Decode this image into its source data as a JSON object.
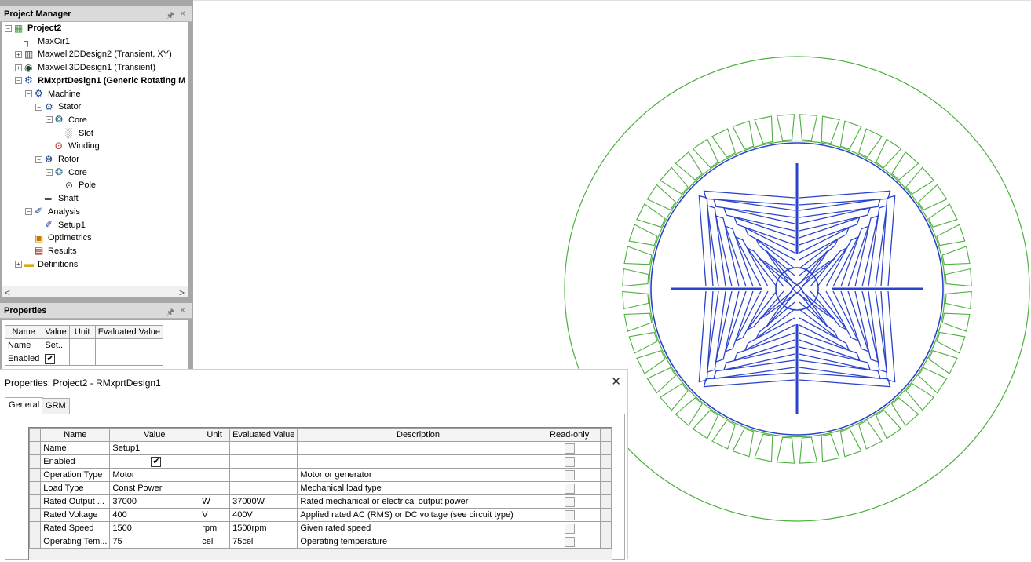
{
  "project_manager": {
    "title": "Project Manager",
    "pin": "↕",
    "close": "×",
    "tree": [
      {
        "label": "Project2",
        "level": 0,
        "toggle": "−",
        "icon": "project-icon",
        "bold": true
      },
      {
        "label": "MaxCir1",
        "level": 1,
        "toggle": "",
        "icon": "circuit-icon",
        "bold": false
      },
      {
        "label": "Maxwell2DDesign2 (Transient, XY)",
        "level": 1,
        "toggle": "+",
        "icon": "maxwell2d-icon",
        "bold": false
      },
      {
        "label": "Maxwell3DDesign1 (Transient)",
        "level": 1,
        "toggle": "+",
        "icon": "maxwell3d-icon",
        "bold": false
      },
      {
        "label": "RMxprtDesign1 (Generic Rotating M",
        "level": 1,
        "toggle": "−",
        "icon": "rmxprt-icon",
        "bold": true
      },
      {
        "label": "Machine",
        "level": 2,
        "toggle": "−",
        "icon": "machine-icon",
        "bold": false
      },
      {
        "label": "Stator",
        "level": 3,
        "toggle": "−",
        "icon": "stator-icon",
        "bold": false
      },
      {
        "label": "Core",
        "level": 4,
        "toggle": "−",
        "icon": "core-icon",
        "bold": false
      },
      {
        "label": "Slot",
        "level": 5,
        "toggle": "",
        "icon": "slot-icon",
        "bold": false
      },
      {
        "label": "Winding",
        "level": 4,
        "toggle": "",
        "icon": "winding-icon",
        "bold": false
      },
      {
        "label": "Rotor",
        "level": 3,
        "toggle": "−",
        "icon": "rotor-icon",
        "bold": false
      },
      {
        "label": "Core",
        "level": 4,
        "toggle": "−",
        "icon": "core-icon",
        "bold": false
      },
      {
        "label": "Pole",
        "level": 5,
        "toggle": "",
        "icon": "pole-icon",
        "bold": false
      },
      {
        "label": "Shaft",
        "level": 3,
        "toggle": "",
        "icon": "shaft-icon",
        "bold": false
      },
      {
        "label": "Analysis",
        "level": 2,
        "toggle": "−",
        "icon": "analysis-icon",
        "bold": false
      },
      {
        "label": "Setup1",
        "level": 3,
        "toggle": "",
        "icon": "setup-icon",
        "bold": false
      },
      {
        "label": "Optimetrics",
        "level": 2,
        "toggle": "",
        "icon": "optimetrics-icon",
        "bold": false
      },
      {
        "label": "Results",
        "level": 2,
        "toggle": "",
        "icon": "results-icon",
        "bold": false
      },
      {
        "label": "Definitions",
        "level": 1,
        "toggle": "+",
        "icon": "folder-icon",
        "bold": false
      }
    ],
    "scroll_left": "<",
    "scroll_right": ">"
  },
  "properties_pane": {
    "title": "Properties",
    "pin": "↕",
    "close": "×",
    "columns": [
      "Name",
      "Value",
      "Unit",
      "Evaluated Value"
    ],
    "rows": [
      {
        "name": "Name",
        "value": "Set...",
        "unit": "",
        "evaluated": ""
      },
      {
        "name": "Enabled",
        "value": "",
        "checked": true,
        "unit": "",
        "evaluated": ""
      }
    ]
  },
  "dialog": {
    "title": "Properties: Project2 - RMxprtDesign1",
    "close": "✕",
    "tabs": [
      {
        "label": "General",
        "active": true
      },
      {
        "label": "GRM",
        "active": false
      }
    ],
    "columns": [
      "Name",
      "Value",
      "Unit",
      "Evaluated Value",
      "Description",
      "Read-only"
    ],
    "rows": [
      {
        "name": "Name",
        "value": "Setup1",
        "unit": "",
        "evaluated": "",
        "description": ""
      },
      {
        "name": "Enabled",
        "value": "",
        "checkbox": true,
        "unit": "",
        "evaluated": "",
        "description": ""
      },
      {
        "name": "Operation Type",
        "value": "Motor",
        "unit": "",
        "evaluated": "",
        "description": "Motor or generator"
      },
      {
        "name": "Load Type",
        "value": "Const Power",
        "unit": "",
        "evaluated": "",
        "description": "Mechanical load type"
      },
      {
        "name": "Rated Output ...",
        "value": "37000",
        "unit": "W",
        "evaluated": "37000W",
        "description": "Rated mechanical or electrical output power"
      },
      {
        "name": "Rated Voltage",
        "value": "400",
        "unit": "V",
        "evaluated": "400V",
        "description": "Applied rated AC (RMS) or DC voltage (see circuit type)"
      },
      {
        "name": "Rated Speed",
        "value": "1500",
        "unit": "rpm",
        "evaluated": "1500rpm",
        "description": "Given rated speed"
      },
      {
        "name": "Operating Tem...",
        "value": "75",
        "unit": "cel",
        "evaluated": "75cel",
        "description": "Operating temperature"
      }
    ]
  },
  "colors": {
    "stator": "#4caf3e",
    "rotor": "#2b43cc",
    "outline": "#4caf3e"
  }
}
